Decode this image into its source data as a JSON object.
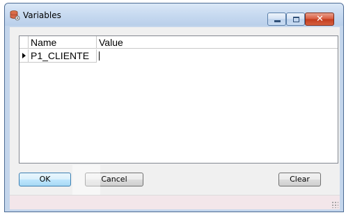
{
  "window": {
    "title": "Variables",
    "title_icon": "database-icon"
  },
  "grid": {
    "columns": [
      "Name",
      "Value"
    ],
    "rows": [
      {
        "name": "P1_CLIENTE",
        "value": "",
        "current": true
      }
    ]
  },
  "buttons": {
    "ok_label": "OK",
    "cancel_label": "Cancel",
    "clear_label": "Clear"
  },
  "colors": {
    "window_frame": "#c4d6ec",
    "close_button": "#c23b1d",
    "default_button": "#a7d9f5"
  }
}
